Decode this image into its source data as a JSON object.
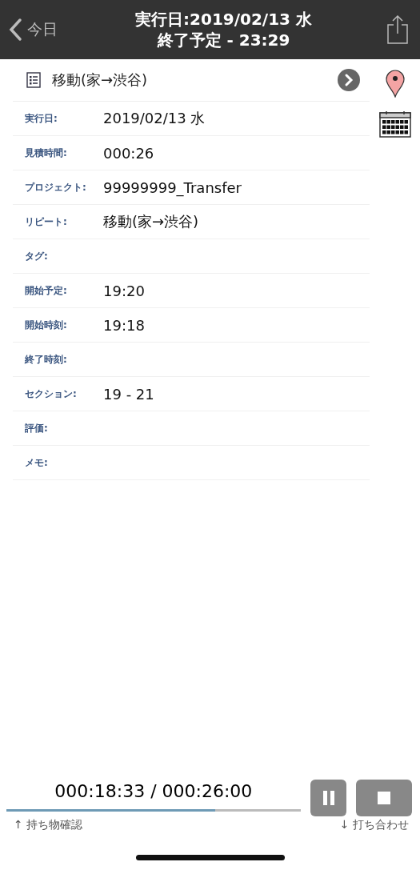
{
  "header": {
    "back_label": "今日",
    "title_line_1": "実行日:2019/02/13 水",
    "title_line_2": "終了予定 - 23:29"
  },
  "task": {
    "title": "移動(家→渋谷)"
  },
  "fields": [
    {
      "label": "実行日:",
      "value": "2019/02/13 水"
    },
    {
      "label": "見積時間:",
      "value": "000:26"
    },
    {
      "label": "プロジェクト:",
      "value": "99999999_Transfer"
    },
    {
      "label": "リピート:",
      "value": "移動(家→渋谷)"
    },
    {
      "label": "タグ:"
    },
    {
      "label": "開始予定:",
      "value": "19:20"
    },
    {
      "label": "開始時刻:",
      "value": "19:18"
    },
    {
      "label": "終了時刻:"
    },
    {
      "label": "セクション:",
      "value": "19 - 21"
    },
    {
      "label": "評価:"
    },
    {
      "label": "メモ:"
    }
  ],
  "timer": {
    "reading": "000:18:33 / 000:26:00",
    "level": 0.71,
    "previous_task": "↑ 持ち物確認",
    "next_task": "↓ 打ち合わせ"
  }
}
